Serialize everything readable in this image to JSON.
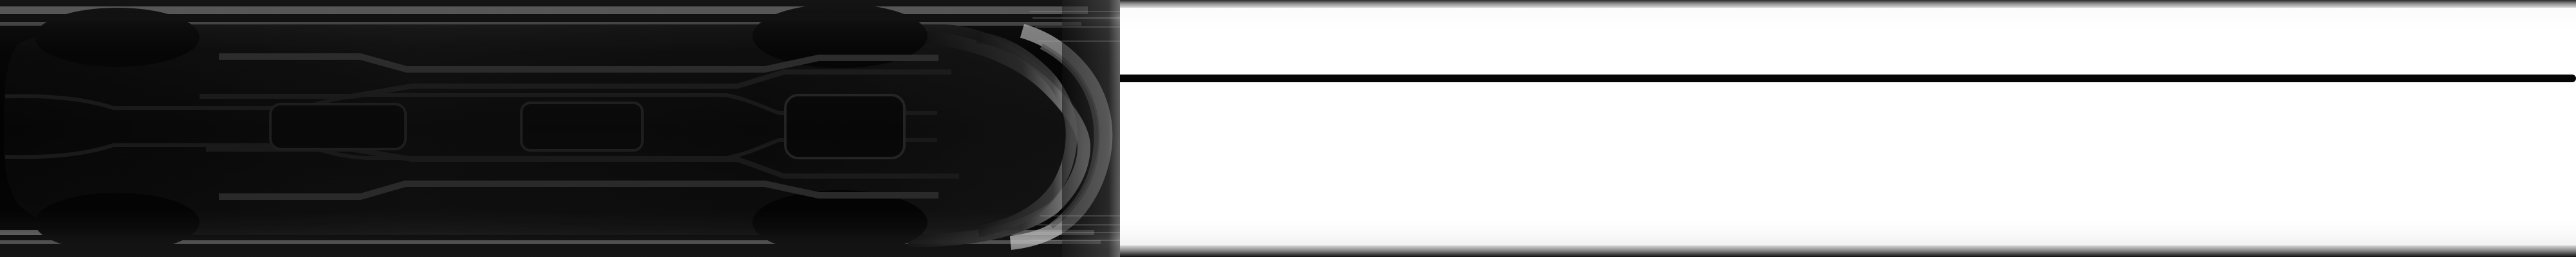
{
  "scene": {
    "type": "line-scan vehicle image",
    "palette": {
      "background": "#ffffff",
      "vehicle": "#000000",
      "shadow": "#111111",
      "highlight": "#d7d7d7",
      "line": "#050505"
    }
  }
}
